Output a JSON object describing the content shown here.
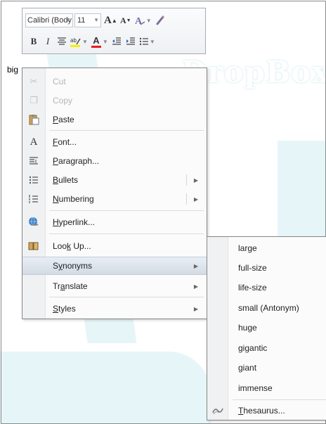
{
  "watermark": {
    "text": "DropBox"
  },
  "document": {
    "selected_word": "big"
  },
  "mini_toolbar": {
    "font_name": "Calibri (Body",
    "font_size": "11",
    "grow_font_glyph": "A",
    "shrink_font_glyph": "A",
    "bold_glyph": "B",
    "italic_glyph": "I",
    "font_color_glyph": "A"
  },
  "context_menu": {
    "items": [
      {
        "label": "Cut",
        "icon": "scissors-icon",
        "disabled": true
      },
      {
        "label": "Copy",
        "icon": "copy-icon",
        "disabled": true
      },
      {
        "label": "Paste",
        "icon": "paste-icon",
        "disabled": false
      },
      {
        "label": "Font...",
        "icon": "font-icon",
        "disabled": false
      },
      {
        "label": "Paragraph...",
        "icon": "paragraph-icon",
        "disabled": false
      },
      {
        "label": "Bullets",
        "icon": "bullets-icon",
        "disabled": false
      },
      {
        "label": "Numbering",
        "icon": "numbering-icon",
        "disabled": false
      },
      {
        "label": "Hyperlink...",
        "icon": "hyperlink-icon",
        "disabled": false
      },
      {
        "label": "Look Up...",
        "icon": "lookup-icon",
        "disabled": false
      },
      {
        "label": "Synonyms",
        "disabled": false,
        "highlighted": true
      },
      {
        "label": "Translate",
        "disabled": false
      },
      {
        "label": "Styles",
        "disabled": false
      }
    ]
  },
  "synonyms_menu": {
    "items": [
      "large",
      "full-size",
      "life-size",
      "small (Antonym)",
      "huge",
      "gigantic",
      "giant",
      "immense"
    ],
    "thesaurus_label": "Thesaurus..."
  }
}
